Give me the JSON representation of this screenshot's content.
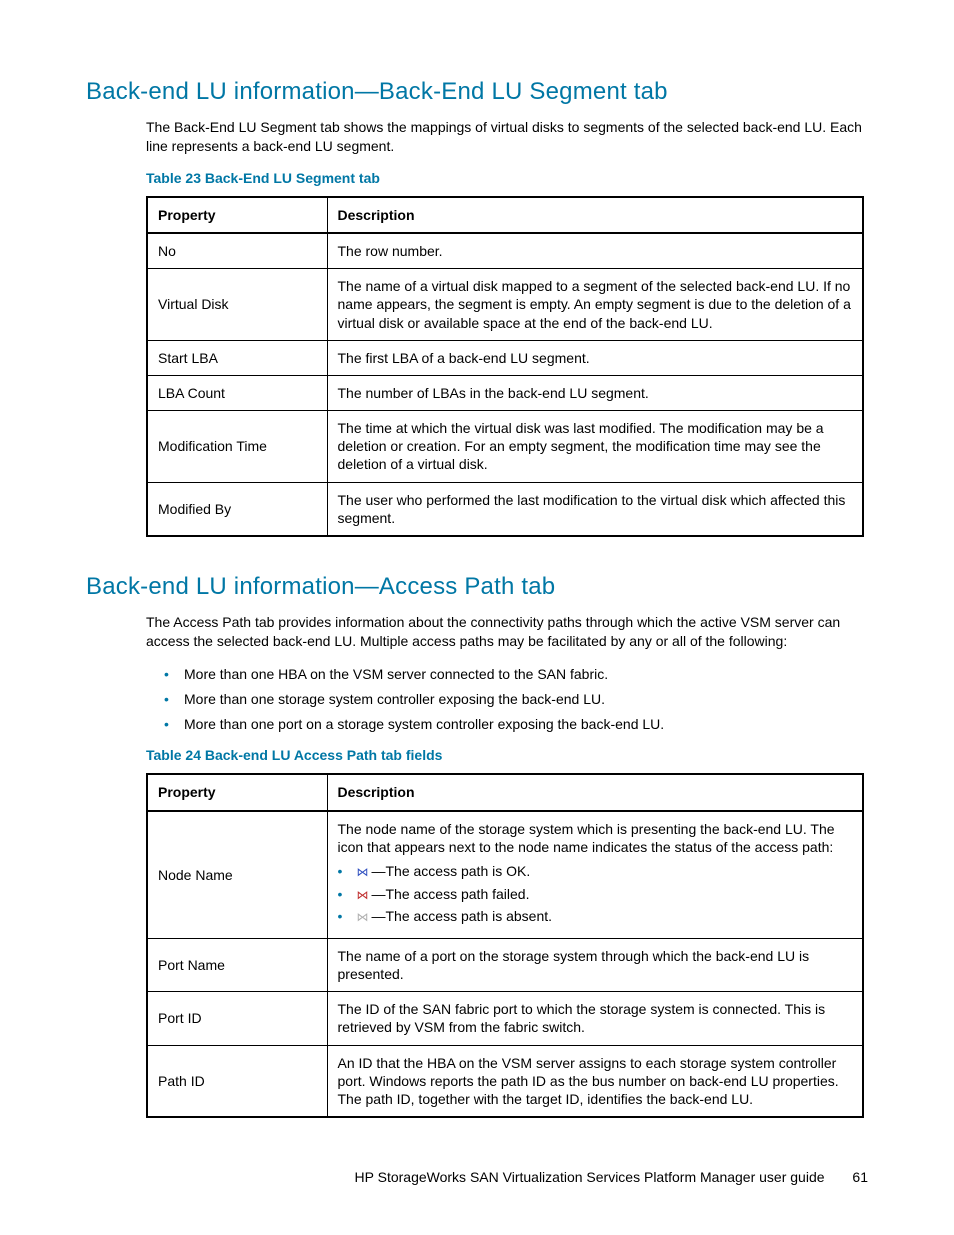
{
  "section1": {
    "heading": "Back-end LU information—Back-End LU Segment tab",
    "intro": "The Back-End LU Segment tab shows the mappings of virtual disks to segments of the selected back-end LU. Each line represents a back-end LU segment.",
    "table_caption": "Table 23 Back-End LU Segment tab",
    "table": {
      "headers": [
        "Property",
        "Description"
      ],
      "rows": [
        {
          "property": "No",
          "description": "The row number."
        },
        {
          "property": "Virtual Disk",
          "description": "The name of a virtual disk mapped to a segment of the selected back-end LU. If no name appears, the segment is empty. An empty segment is due to the deletion of a virtual disk or available space at the end of the back-end LU."
        },
        {
          "property": "Start LBA",
          "description": "The first LBA of a back-end LU segment."
        },
        {
          "property": "LBA Count",
          "description": "The number of LBAs in the back-end LU segment."
        },
        {
          "property": "Modification Time",
          "description": "The time at which the virtual disk was last modified. The modification may be a deletion or creation. For an empty segment, the modification time may see the deletion of a virtual disk."
        },
        {
          "property": "Modified By",
          "description": "The user who performed the last modification to the virtual disk which affected this segment."
        }
      ]
    }
  },
  "section2": {
    "heading": "Back-end LU information—Access Path tab",
    "intro": "The Access Path tab provides information about the connectivity paths through which the active VSM server can access the selected back-end LU. Multiple access paths may be facilitated by any or all of the following:",
    "bullets": [
      "More than one HBA on the VSM server connected to the SAN fabric.",
      "More than one storage system controller exposing the back-end LU.",
      "More than one port on a storage system controller exposing the back-end LU."
    ],
    "table_caption": "Table 24 Back-end LU Access Path tab fields",
    "table": {
      "headers": [
        "Property",
        "Description"
      ],
      "rows": [
        {
          "property": "Node Name",
          "description_lead": "The node name of the storage system which is presenting the back-end LU. The icon that appears next to the node name indicates the status of the access path:",
          "icon_items": [
            {
              "icon": "⋈",
              "class": "icon-ok",
              "text": "—The access path is OK."
            },
            {
              "icon": "⋈",
              "class": "icon-fail",
              "text": "—The access path failed."
            },
            {
              "icon": "⋈",
              "class": "icon-absent",
              "text": "—The access path is absent."
            }
          ]
        },
        {
          "property": "Port Name",
          "description": "The name of a port on the storage system through which the back-end LU is presented."
        },
        {
          "property": "Port ID",
          "description": "The ID of the SAN fabric port to which the storage system is connected. This is retrieved by VSM from the fabric switch."
        },
        {
          "property": "Path ID",
          "description": "An ID that the HBA on the VSM server assigns to each storage system controller port. Windows reports the path ID as the bus number on back-end LU properties. The path ID, together with the target ID, identifies the back-end LU."
        }
      ]
    }
  },
  "footer": {
    "title": "HP StorageWorks SAN Virtualization Services Platform Manager user guide",
    "page": "61"
  }
}
